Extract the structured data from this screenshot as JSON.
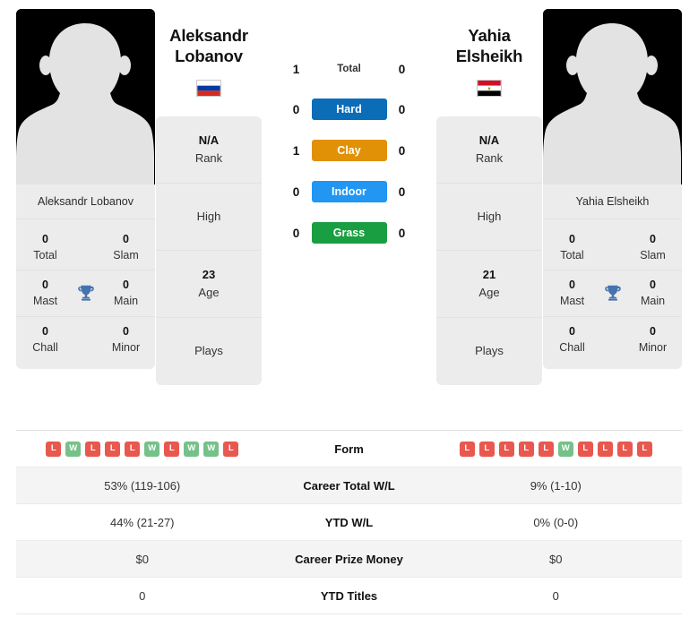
{
  "players": {
    "left": {
      "first_name": "Aleksandr",
      "last_name": "Lobanov",
      "full_name": "Aleksandr Lobanov",
      "country": "Russia",
      "flag_icon": "flag-russia-icon",
      "avatar_icon": "player-avatar-placeholder-icon",
      "titles": {
        "total_value": "0",
        "total_label": "Total",
        "slam_value": "0",
        "slam_label": "Slam",
        "mast_value": "0",
        "mast_label": "Mast",
        "main_value": "0",
        "main_label": "Main",
        "chall_value": "0",
        "chall_label": "Chall",
        "minor_value": "0",
        "minor_label": "Minor",
        "trophy_icon": "trophy-icon"
      },
      "info": {
        "rank_value": "N/A",
        "rank_label": "Rank",
        "high_value": "",
        "high_label": "High",
        "age_value": "23",
        "age_label": "Age",
        "plays_value": "",
        "plays_label": "Plays"
      },
      "form": [
        "L",
        "W",
        "L",
        "L",
        "L",
        "W",
        "L",
        "W",
        "W",
        "L"
      ],
      "career_total_wl": "53% (119-106)",
      "ytd_wl": "44% (21-27)",
      "career_prize_money": "$0",
      "ytd_titles": "0"
    },
    "right": {
      "first_name": "Yahia",
      "last_name": "Elsheikh",
      "full_name": "Yahia Elsheikh",
      "country": "Egypt",
      "flag_icon": "flag-egypt-icon",
      "avatar_icon": "player-avatar-placeholder-icon",
      "titles": {
        "total_value": "0",
        "total_label": "Total",
        "slam_value": "0",
        "slam_label": "Slam",
        "mast_value": "0",
        "mast_label": "Mast",
        "main_value": "0",
        "main_label": "Main",
        "chall_value": "0",
        "chall_label": "Chall",
        "minor_value": "0",
        "minor_label": "Minor",
        "trophy_icon": "trophy-icon"
      },
      "info": {
        "rank_value": "N/A",
        "rank_label": "Rank",
        "high_value": "",
        "high_label": "High",
        "age_value": "21",
        "age_label": "Age",
        "plays_value": "",
        "plays_label": "Plays"
      },
      "form": [
        "L",
        "L",
        "L",
        "L",
        "L",
        "W",
        "L",
        "L",
        "L",
        "L"
      ],
      "career_total_wl": "9% (1-10)",
      "ytd_wl": "0% (0-0)",
      "career_prize_money": "$0",
      "ytd_titles": "0"
    }
  },
  "head_to_head": {
    "rows": [
      {
        "label": "Total",
        "left": "1",
        "right": "0",
        "color": ""
      },
      {
        "label": "Hard",
        "left": "0",
        "right": "0",
        "color": "#0b6cb7"
      },
      {
        "label": "Clay",
        "left": "1",
        "right": "0",
        "color": "#e09105"
      },
      {
        "label": "Indoor",
        "left": "0",
        "right": "0",
        "color": "#2196f3"
      },
      {
        "label": "Grass",
        "left": "0",
        "right": "0",
        "color": "#1a9e42"
      }
    ]
  },
  "comparison_table": {
    "form_label": "Form",
    "rows": [
      {
        "label": "Career Total W/L",
        "left": "53% (119-106)",
        "right": "9% (1-10)"
      },
      {
        "label": "YTD W/L",
        "left": "44% (21-27)",
        "right": "0% (0-0)"
      },
      {
        "label": "Career Prize Money",
        "left": "$0",
        "right": "$0"
      },
      {
        "label": "YTD Titles",
        "left": "0",
        "right": "0"
      }
    ]
  },
  "colors": {
    "win_badge": "#76c189",
    "loss_badge": "#e8584f",
    "trophy": "#4573ad",
    "card_bg": "#ececec",
    "row_alt_bg": "#f4f4f4"
  }
}
